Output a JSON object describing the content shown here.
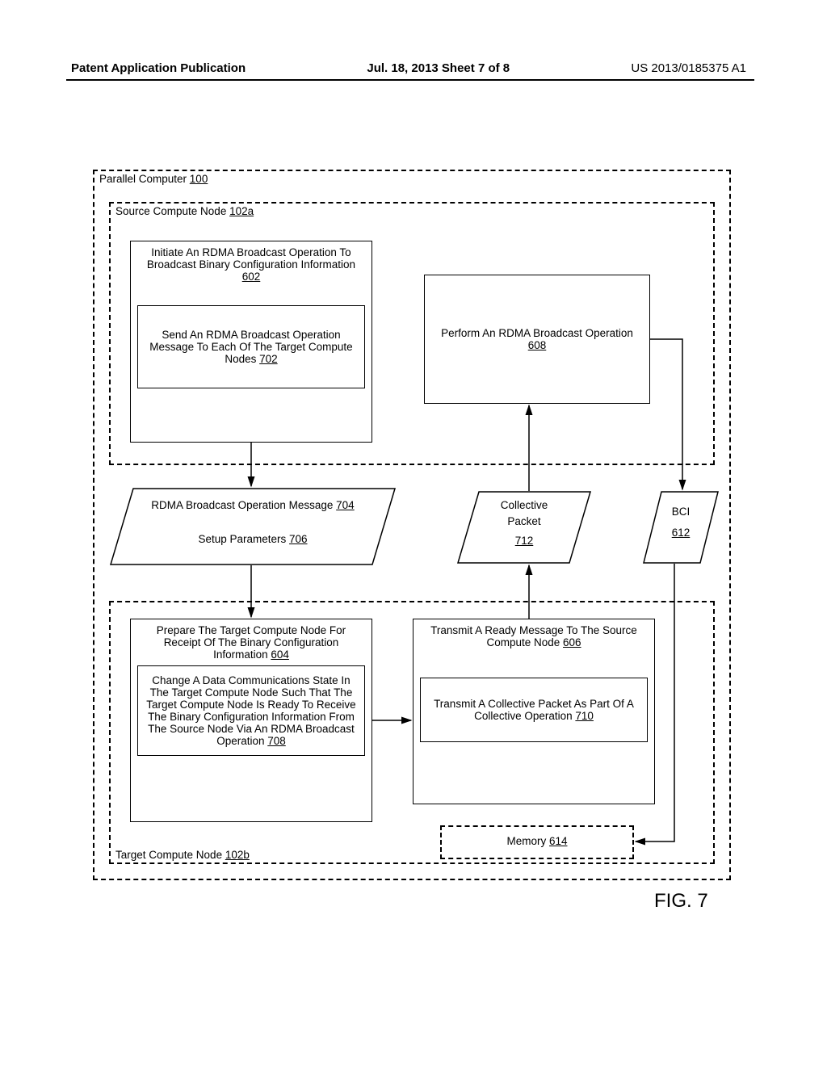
{
  "header": {
    "left": "Patent Application Publication",
    "mid": "Jul. 18, 2013  Sheet 7 of 8",
    "right": "US 2013/0185375 A1"
  },
  "parallel": {
    "label": "Parallel Computer ",
    "ref": "100"
  },
  "source": {
    "label": "Source Compute Node ",
    "ref": "102a"
  },
  "target": {
    "label": "Target Compute Node ",
    "ref": "102b"
  },
  "b602": {
    "text": "Initiate An RDMA Broadcast Operation To Broadcast Binary Configuration Information ",
    "ref": "602"
  },
  "b702": {
    "text": "Send An RDMA Broadcast Operation Message To Each Of The Target Compute Nodes ",
    "ref": "702"
  },
  "b608": {
    "text": "Perform An RDMA Broadcast Operation ",
    "ref": "608"
  },
  "msg704": {
    "text": "RDMA Broadcast Operation Message ",
    "ref": "704"
  },
  "msg706": {
    "text": "Setup Parameters ",
    "ref": "706"
  },
  "pkt712": {
    "line1": "Collective",
    "line2": "Packet",
    "ref": "712"
  },
  "bci612": {
    "line1": "BCI",
    "ref": "612"
  },
  "b604": {
    "text": "Prepare The Target Compute Node For Receipt Of The Binary Configuration Information ",
    "ref": "604"
  },
  "b708": {
    "text": "Change A Data Communications State In The Target Compute Node Such That The Target Compute Node Is Ready To Receive The Binary Configuration Information From The Source Node Via An RDMA Broadcast Operation ",
    "ref": "708"
  },
  "b606": {
    "text": "Transmit A Ready Message To The Source Compute Node ",
    "ref": "606"
  },
  "b710": {
    "text": "Transmit A Collective Packet As Part Of A Collective Operation ",
    "ref": "710"
  },
  "mem614": {
    "text": "Memory ",
    "ref": "614"
  },
  "fig": "FIG. 7"
}
